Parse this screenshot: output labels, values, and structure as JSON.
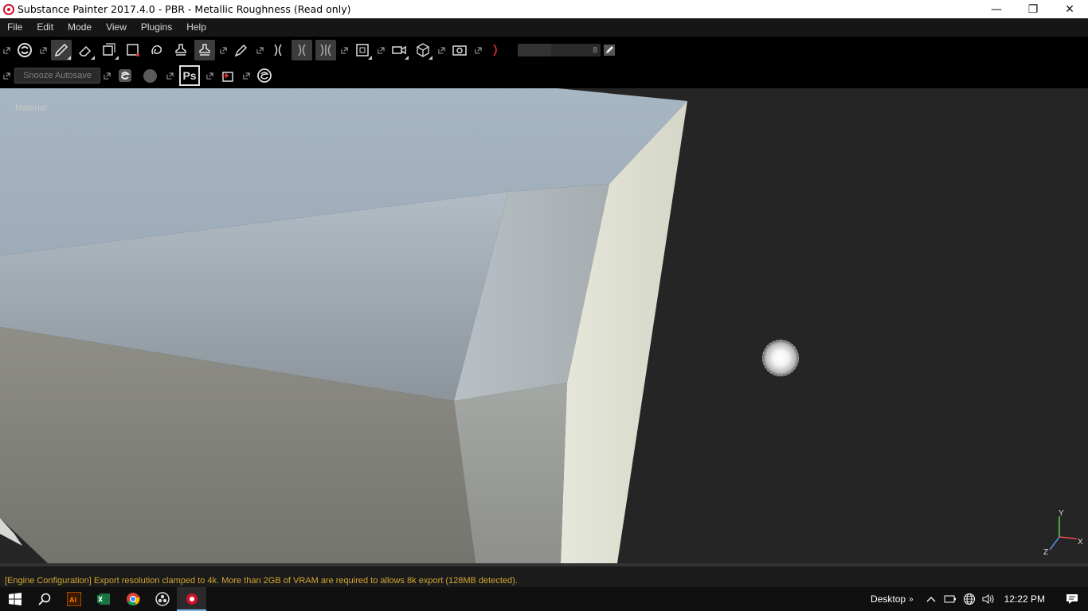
{
  "window": {
    "title": "Substance Painter 2017.4.0 - PBR - Metallic Roughness (Read only)",
    "minimize": "—",
    "maximize": "❐",
    "close": "✕"
  },
  "menu": {
    "items": [
      "File",
      "Edit",
      "Mode",
      "View",
      "Plugins",
      "Help"
    ]
  },
  "toolbar": {
    "brush_size_value": "8",
    "snooze_label": "Snooze Autosave",
    "ps_label": "Ps",
    "active_tool": "paint-brush"
  },
  "viewport": {
    "label": "Material",
    "background_color": "#252525",
    "axis_labels": {
      "y": "Y",
      "x": "X",
      "z": "Z"
    }
  },
  "status": {
    "message": "[Engine Configuration] Export resolution clamped to 4k. More than 2GB of VRAM are required to allows 8k export (128MB detected).",
    "color": "#d2a531"
  },
  "taskbar": {
    "desktop_label": "Desktop",
    "chevron": "»",
    "time": "12:22 PM"
  }
}
